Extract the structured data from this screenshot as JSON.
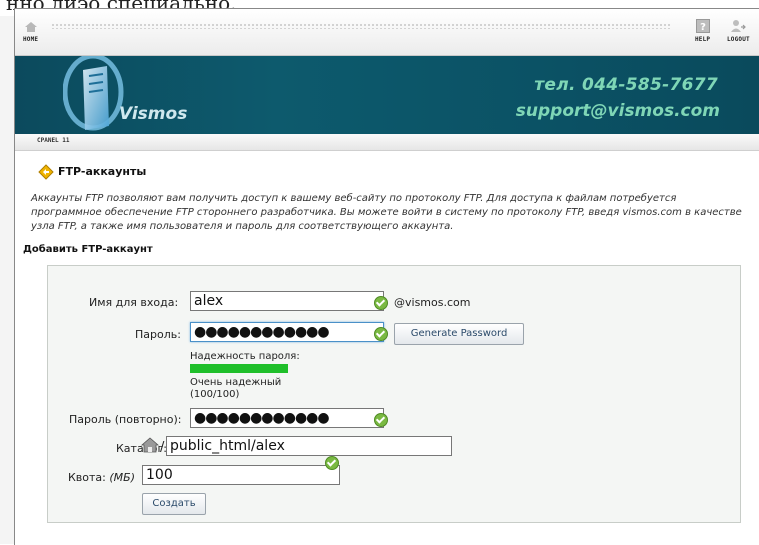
{
  "background": {
    "partial_heading": "нно лиэо специально."
  },
  "topbar": {
    "home_label": "HOME",
    "help_label": "HELP",
    "logout_label": "LOGOUT"
  },
  "banner": {
    "brand": "Vismos",
    "phone": "тел. 044-585-7677",
    "email": "support@vismos.com",
    "accent_color": "#7fd6b6",
    "background_color": "#0c4a5d"
  },
  "cpanel_tab": "CPANEL 11",
  "section": {
    "title": "FTP-аккаунты",
    "description": "Аккаунты FTP позволяют вам получить доступ к вашему веб-сайту по протоколу FTP. Для доступа к файлам потребуется программное обеспечение FTP стороннего разработчика. Вы можете войти в систему по протоколу FTP, введя vismos.com в качестве узла FTP, а также имя пользователя и пароль для соответствующего аккаунта."
  },
  "form": {
    "heading": "Добавить FTP-аккаунт",
    "login_label": "Имя для входа:",
    "login_value": "alex",
    "domain_suffix": "@vismos.com",
    "password_label": "Пароль:",
    "password_masked": "●●●●●●●●●●●●",
    "generate_button": "Generate Password",
    "strength_label": "Надежность пароля:",
    "strength_text": "Очень надежный",
    "strength_score": "(100/100)",
    "strength_fraction": 1.0,
    "strength_color": "#1fbf2a",
    "password_repeat_label": "Пароль (повторно):",
    "password_repeat_masked": "●●●●●●●●●●●●",
    "directory_label": "Каталог:",
    "directory_slash": "/",
    "directory_value": "public_html/alex",
    "quota_label": "Квота:",
    "quota_unit": "(МБ)",
    "quota_value": "100",
    "submit_button": "Создать"
  },
  "icons": [
    "home-icon",
    "help-icon",
    "logout-icon",
    "ftp-icon",
    "check-icon",
    "home-folder-icon"
  ]
}
